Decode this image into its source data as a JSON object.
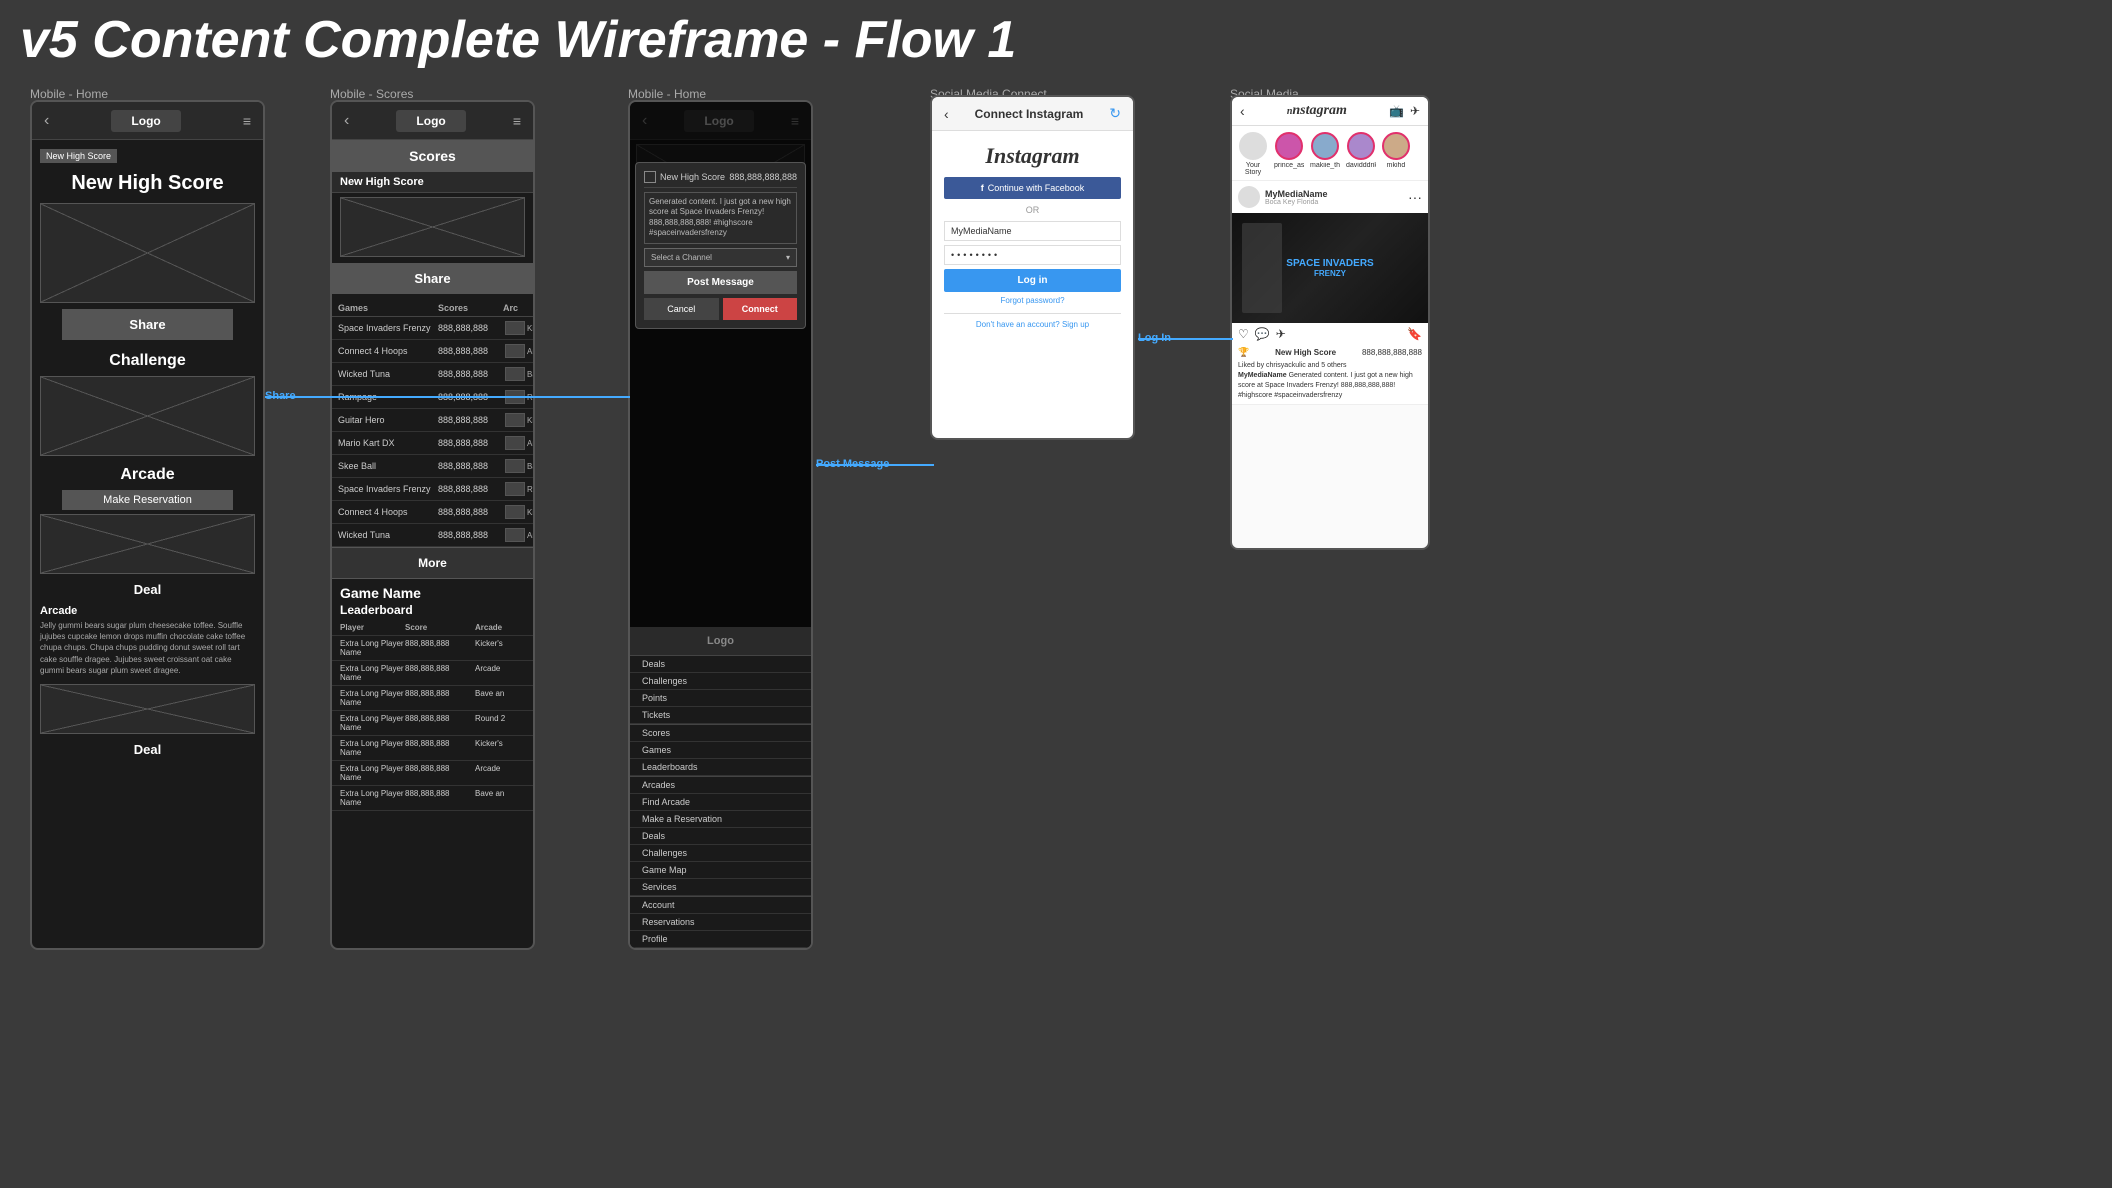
{
  "title": "v5 Content Complete Wireframe - Flow 1",
  "frame_labels": {
    "mobile_home_1": "Mobile - Home",
    "mobile_scores": "Mobile - Scores",
    "mobile_home_2": "Mobile - Home",
    "social_media_connect": "Social Media Connect",
    "social_media": "Social Media"
  },
  "mobile_header": {
    "logo": "Logo",
    "back": "‹",
    "menu": "≡"
  },
  "frame1": {
    "new_high_score_tag": "New High Score",
    "big_title": "New High Score",
    "share_btn": "Share",
    "challenge_title": "Challenge",
    "arcade_title": "Arcade",
    "make_reservation_btn": "Make Reservation",
    "deal_text": "Deal",
    "deal_text2": "Deal",
    "arcade_section": "Arcade",
    "arcade_desc": "Jelly gummi bears sugar plum cheesecake toffee. Souffle jujubes cupcake lemon drops muffin chocolate cake toffee chupa chups. Chupa chups pudding donut sweet roll tart cake souffle dragee. Jujubes sweet croissant oat cake gummi bears sugar plum sweet dragee."
  },
  "frame2": {
    "scores_header": "Scores",
    "new_high_score": "New High Score",
    "share_btn": "Share",
    "table_headers": [
      "Games",
      "Scores",
      "Arc"
    ],
    "table_rows": [
      {
        "game": "Space Invaders Frenzy",
        "score": "888,888,888",
        "arc": "Kick"
      },
      {
        "game": "Connect 4 Hoops",
        "score": "888,888,888",
        "arc": "Arc"
      },
      {
        "game": "Wicked Tuna",
        "score": "888,888,888",
        "arc": "Baw"
      },
      {
        "game": "Rampage",
        "score": "888,888,888",
        "arc": "Rou"
      },
      {
        "game": "Guitar Hero",
        "score": "888,888,888",
        "arc": "Kick"
      },
      {
        "game": "Mario Kart DX",
        "score": "888,888,888",
        "arc": "Arc"
      },
      {
        "game": "Skee Ball",
        "score": "888,888,888",
        "arc": "Baw"
      },
      {
        "game": "Space Invaders Frenzy",
        "score": "888,888,888",
        "arc": "Rou"
      },
      {
        "game": "Connect 4 Hoops",
        "score": "888,888,888",
        "arc": "Kick"
      },
      {
        "game": "Wicked Tuna",
        "score": "888,888,888",
        "arc": "Arc"
      }
    ],
    "more_btn": "More",
    "game_name": "Game Name",
    "leaderboard_title": "Leaderboard",
    "lb_headers": [
      "Player",
      "Score",
      "Arcade"
    ],
    "lb_rows": [
      {
        "player": "Extra Long Player Name",
        "score": "888,888,888",
        "arcade": "Kicker's"
      },
      {
        "player": "Extra Long Player Name",
        "score": "888,888,888",
        "arcade": "Arcade"
      },
      {
        "player": "Extra Long Player Name",
        "score": "888,888,888",
        "arcade": "Bave an"
      },
      {
        "player": "Extra Long Player Name",
        "score": "888,888,888",
        "arcade": "Round 2"
      },
      {
        "player": "Extra Long Player Name",
        "score": "888,888,888",
        "arcade": "Kicker's"
      },
      {
        "player": "Extra Long Player Name",
        "score": "888,888,888",
        "arcade": "Arcade"
      },
      {
        "player": "Extra Long Player Name",
        "score": "888,888,888",
        "arcade": "Bave an"
      }
    ]
  },
  "frame3": {
    "logo": "Logo",
    "new_high_score_label": "New High Score",
    "score_value": "888,888,888,888",
    "message_text": "Generated content. I just got a new high score at Space Invaders Frenzy! 888,888,888,888! #highscore #spaceinvadersfrenzy",
    "select_channel": "Select a Channel",
    "post_btn": "Post Message",
    "cancel_btn": "Cancel",
    "connect_btn": "Connect",
    "logo_area": "Logo",
    "nav_items_1": [
      "Deals",
      "Challenges",
      "Points",
      "Tickets"
    ],
    "nav_items_2": [
      "Scores",
      "Games",
      "Leaderboards"
    ],
    "nav_items_3": [
      "Arcades",
      "Find Arcade",
      "Make a Reservation",
      "Deals",
      "Challenges",
      "Game Map",
      "Services"
    ],
    "nav_items_4": [
      "Account",
      "Reservations",
      "Profile"
    ]
  },
  "frame4": {
    "title": "Connect Instagram",
    "instagram_logo": "Instagram",
    "fb_btn": "Continue with Facebook",
    "or_text": "OR",
    "username_placeholder": "MyMediaName",
    "password_value": "••••••••",
    "login_btn": "Log in",
    "forgot_password": "Forgot password?",
    "signup_text": "Don't have an account?",
    "signup_link": "Sign up",
    "log_in_connector": "Log In"
  },
  "frame5": {
    "ig_logo": "nstagram",
    "my_media_name": "MyMediaName",
    "my_media_sub": "Boca Key Florida",
    "your_story": "Your Story",
    "stories": [
      "prince_as...",
      "makiie_thea...",
      "davidddrik...",
      "mkihd"
    ],
    "new_high_score_label": "New High Score",
    "new_high_score_score": "888,888,888,888",
    "liked_by": "Liked by chrisyackulic and 5 others",
    "caption_name": "MyMediaName",
    "caption_text": "Generated content. I just got a new high score at Space Invaders Frenzy! 888,888,888,888! #highscore #spaceinvadersfrenzy",
    "game_title": "SPACE INVADERS",
    "game_subtitle": "FRENZY"
  },
  "connectors": {
    "share_label": "Share",
    "post_message_label": "Post Message",
    "log_in_label": "Log In"
  }
}
